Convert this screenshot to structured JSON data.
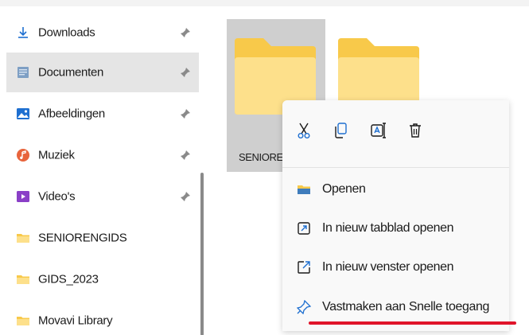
{
  "sidebar": {
    "items": [
      {
        "label": "Downloads",
        "icon": "download-icon",
        "pinned": true,
        "selected": false
      },
      {
        "label": "Documenten",
        "icon": "documents-icon",
        "pinned": true,
        "selected": true
      },
      {
        "label": "Afbeeldingen",
        "icon": "pictures-icon",
        "pinned": true,
        "selected": false
      },
      {
        "label": "Muziek",
        "icon": "music-icon",
        "pinned": true,
        "selected": false
      },
      {
        "label": "Video's",
        "icon": "video-icon",
        "pinned": true,
        "selected": false
      },
      {
        "label": "SENIORENGIDS",
        "icon": "folder-icon",
        "pinned": false,
        "selected": false
      },
      {
        "label": "GIDS_2023",
        "icon": "folder-icon",
        "pinned": false,
        "selected": false
      },
      {
        "label": "Movavi Library",
        "icon": "folder-icon",
        "pinned": false,
        "selected": false
      }
    ]
  },
  "content": {
    "folders": [
      {
        "name": "SENIORE",
        "selected": true
      },
      {
        "name": "",
        "selected": false
      }
    ]
  },
  "context_menu": {
    "toolbar": [
      {
        "icon": "cut-icon",
        "action": "cut"
      },
      {
        "icon": "copy-icon",
        "action": "copy"
      },
      {
        "icon": "rename-icon",
        "action": "rename"
      },
      {
        "icon": "delete-icon",
        "action": "delete"
      }
    ],
    "items": [
      {
        "label": "Openen",
        "icon": "folder-open-icon"
      },
      {
        "label": "In nieuw tabblad openen",
        "icon": "new-tab-icon"
      },
      {
        "label": "In nieuw venster openen",
        "icon": "new-window-icon"
      },
      {
        "label": "Vastmaken aan Snelle toegang",
        "icon": "pin-icon",
        "highlighted": true
      }
    ]
  },
  "colors": {
    "accent_underline": "#e0142a",
    "folder_yellow": "#f8c94a",
    "folder_light": "#fde08b",
    "selection": "#e5e5e5",
    "icon_blue": "#1e6fd0"
  }
}
